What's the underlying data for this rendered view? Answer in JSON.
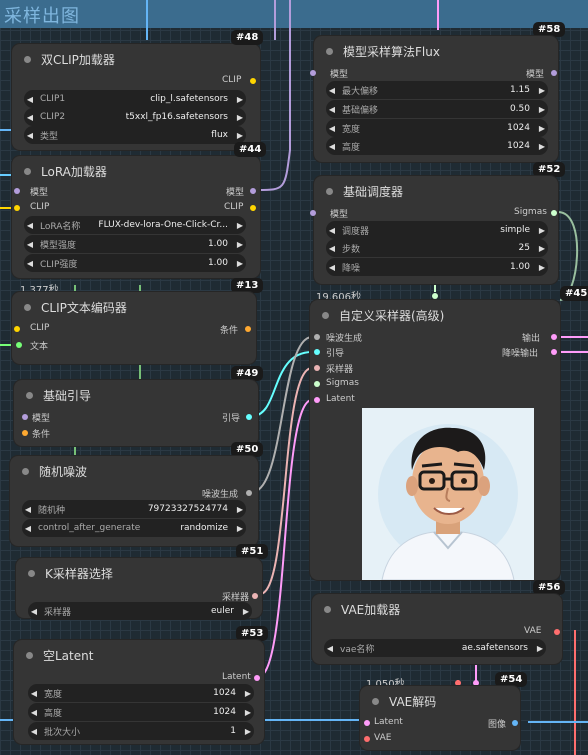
{
  "group": {
    "title": "采样出图"
  },
  "colors": {
    "model": "#b39ddb",
    "clip": "#ffd500",
    "conditioning": "#ffa931",
    "latent": "#ff9cf9",
    "vae": "#ff6e6e",
    "image": "#64b5f6",
    "noise": "#b0b0b0",
    "sampler": "#ecb4b4",
    "guider": "#66ffff",
    "sigmas": "#cdffcd",
    "string": "#77ff77"
  },
  "nodes": {
    "dualclip": {
      "title": "双CLIP加载器",
      "badge": "#48",
      "out": "CLIP",
      "widgets": [
        {
          "label": "CLIP1",
          "value": "clip_l.safetensors"
        },
        {
          "label": "CLIP2",
          "value": "t5xxl_fp16.safetensors"
        },
        {
          "label": "类型",
          "value": "flux"
        }
      ]
    },
    "lora": {
      "title": "LoRA加载器",
      "badge": "#44",
      "in": [
        "模型",
        "CLIP"
      ],
      "out": [
        "模型",
        "CLIP"
      ],
      "widgets": [
        {
          "label": "LoRA名称",
          "value": "FLUX-dev-lora-One-Click-Cr..."
        },
        {
          "label": "模型强度",
          "value": "1.00"
        },
        {
          "label": "CLIP强度",
          "value": "1.00"
        }
      ]
    },
    "cliptext": {
      "title": "CLIP文本编码器",
      "badge": "#13",
      "timing": "1.377秒",
      "in": [
        "CLIP",
        "文本"
      ],
      "out": "条件"
    },
    "guidance": {
      "title": "基础引导",
      "badge": "#49",
      "in": [
        "模型",
        "条件"
      ],
      "out": "引导"
    },
    "noise": {
      "title": "随机噪波",
      "badge": "#50",
      "out": "噪波生成",
      "widgets": [
        {
          "label": "随机种",
          "value": "797233275247​74"
        },
        {
          "label": "control_after_generate",
          "value": "randomize"
        }
      ]
    },
    "ksampler": {
      "title": "K采样器选择",
      "badge": "#51",
      "out": "采样器",
      "widgets": [
        {
          "label": "采样器",
          "value": "euler"
        }
      ]
    },
    "latent": {
      "title": "空Latent",
      "badge": "#53",
      "out": "Latent",
      "widgets": [
        {
          "label": "宽度",
          "value": "1024"
        },
        {
          "label": "高度",
          "value": "1024"
        },
        {
          "label": "批次大小",
          "value": "1"
        }
      ]
    },
    "modelsampling": {
      "title": "模型采样算法Flux",
      "badge": "#58",
      "in": "模型",
      "out": "模型",
      "widgets": [
        {
          "label": "最大偏移",
          "value": "1.15"
        },
        {
          "label": "基础偏移",
          "value": "0.50"
        },
        {
          "label": "宽度",
          "value": "1024"
        },
        {
          "label": "高度",
          "value": "1024"
        }
      ]
    },
    "scheduler": {
      "title": "基础调度器",
      "badge": "#52",
      "in": "模型",
      "out": "Sigmas",
      "widgets": [
        {
          "label": "调度器",
          "value": "simple"
        },
        {
          "label": "步数",
          "value": "25"
        },
        {
          "label": "降噪",
          "value": "1.00"
        }
      ]
    },
    "customsampler": {
      "title": "自定义采样器(高级)",
      "badge": "#45",
      "timing": "19.606秒",
      "in": [
        "噪波生成",
        "引导",
        "采样器",
        "Sigmas",
        "Latent"
      ],
      "out": [
        "输出",
        "降噪输出"
      ]
    },
    "vaeloader": {
      "title": "VAE加载器",
      "badge": "#56",
      "out": "VAE",
      "widgets": [
        {
          "label": "vae名称",
          "value": "ae.safetensors"
        }
      ]
    },
    "vaedecode": {
      "title": "VAE解码",
      "badge": "#54",
      "timing": "1.050秒",
      "in": [
        "Latent",
        "VAE"
      ],
      "out": "图像"
    }
  }
}
